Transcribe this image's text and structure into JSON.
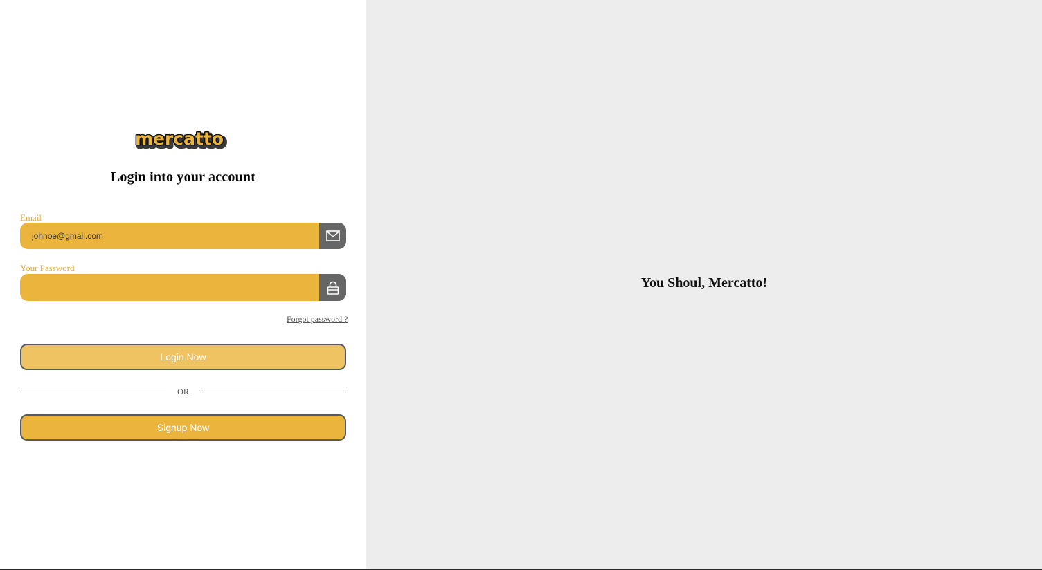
{
  "brand": {
    "logo_text": "mercatto",
    "accent_color": "#ebb43c",
    "icon_bg_color": "#666666"
  },
  "login": {
    "title": "Login into your account",
    "email": {
      "label": "Email",
      "value": "johnoe@gmail.com",
      "icon": "mail-icon"
    },
    "password": {
      "label": "Your Password",
      "value": "",
      "icon": "lock-icon"
    },
    "forgot_password": "Forgot password ?",
    "login_button": "Login Now",
    "divider_text": "OR",
    "signup_button": "Signup Now"
  },
  "hero": {
    "message": "You Shoul, Mercatto!"
  }
}
